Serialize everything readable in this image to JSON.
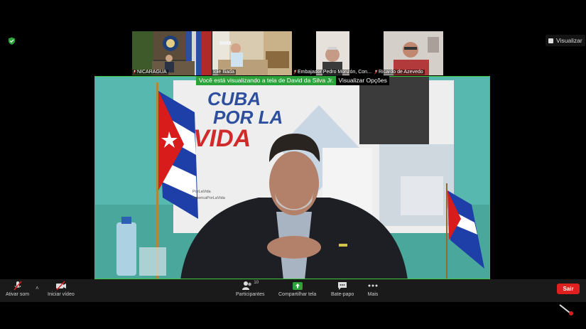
{
  "view_button": {
    "label": "Visualizar"
  },
  "participants_strip": [
    {
      "name": "NICARAGUA"
    },
    {
      "name": "Iole Iliada"
    },
    {
      "name": "Embajador Pedro Monzón, Con..."
    },
    {
      "name": "Ricardo de Azevedo"
    }
  ],
  "share_banner": {
    "viewing_text": "Você está visualizando a tela de David da Silva Jr.",
    "options_label": "Visualizar Opções"
  },
  "shared_screen": {
    "poster_title_line1": "CUBA",
    "poster_title_line2": "POR LA",
    "poster_title_line3": "VIDA",
    "poster_small_1": "PorLaVida",
    "poster_small_2": "AmericaPorLaVida"
  },
  "toolbar": {
    "audio_label": "Ativar som",
    "video_label": "Iniciar vídeo",
    "participants_label": "Participantes",
    "participants_count": "10",
    "share_label": "Compartilhar tela",
    "chat_label": "Bate-papo",
    "more_label": "Mais",
    "leave_label": "Sair"
  },
  "colors": {
    "accent_green": "#2ca33a",
    "leave_red": "#e0201e",
    "share_border": "#3ec63e"
  }
}
